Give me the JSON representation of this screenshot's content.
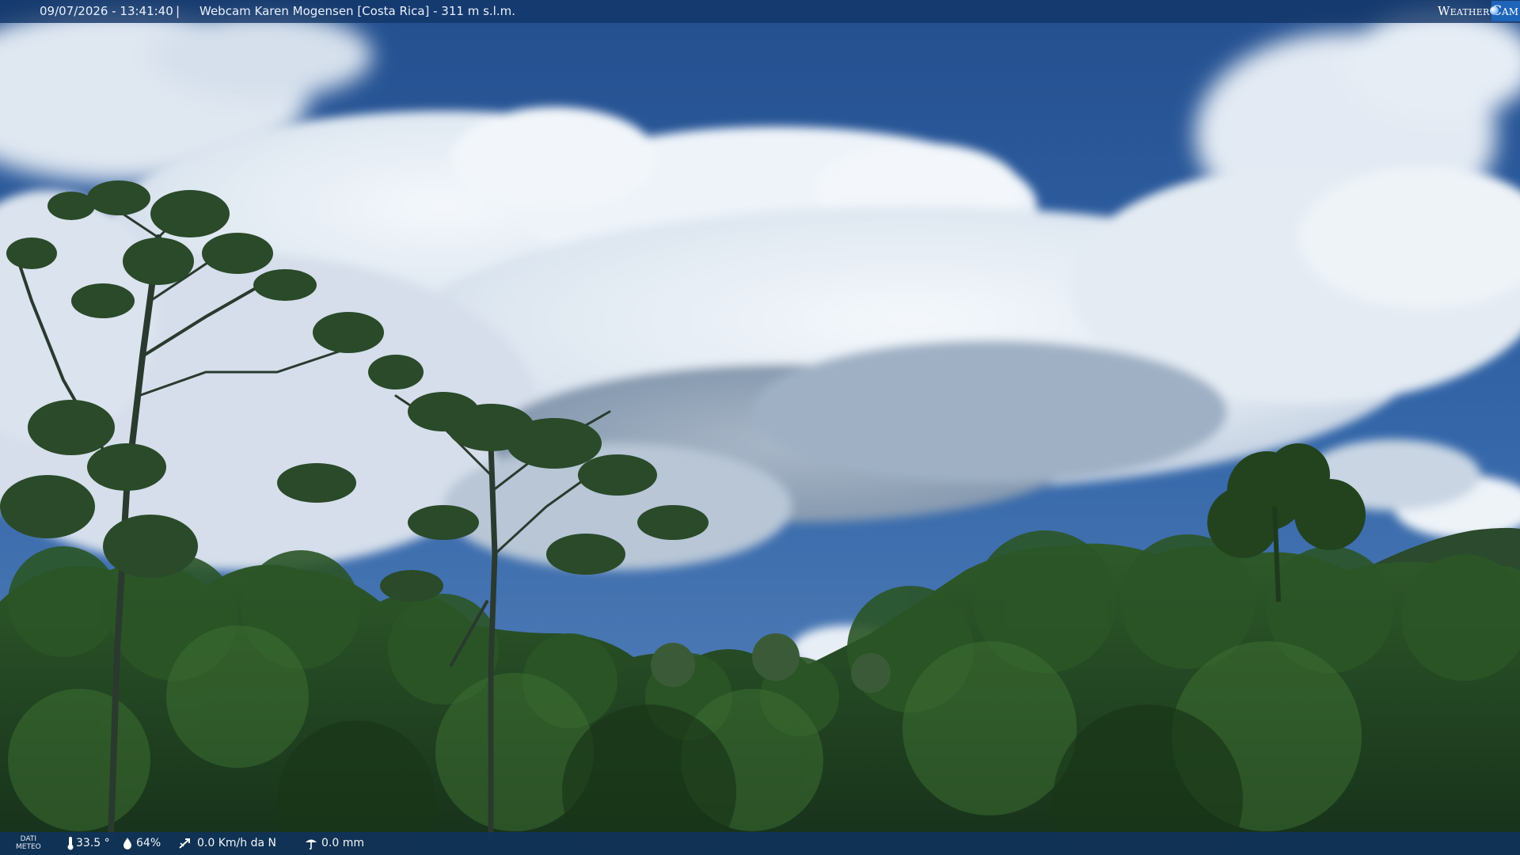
{
  "header": {
    "datetime": "09/07/2026 - 13:41:40",
    "separator": "|",
    "title": "Webcam Karen Mogensen [Costa Rica] - 311 m s.l.m."
  },
  "brand": {
    "weather": "Weather",
    "cam": "Cam"
  },
  "weather_bar": {
    "label_line1": "DATI",
    "label_line2": "METEO",
    "temperature": "33.5 °",
    "humidity": "64%",
    "wind": "0.0 Km/h da N",
    "rain": "0.0 mm",
    "icons": {
      "temperature": "thermometer-icon",
      "humidity": "humidity-drop-icon",
      "wind": "wind-icon",
      "rain": "rain-gauge-icon"
    }
  },
  "colors": {
    "sky": "#2f5fa0",
    "cloud": "#e8eef5",
    "forest": "#24451f",
    "bar": "#12346a",
    "brand_blue": "#1e64b8"
  }
}
